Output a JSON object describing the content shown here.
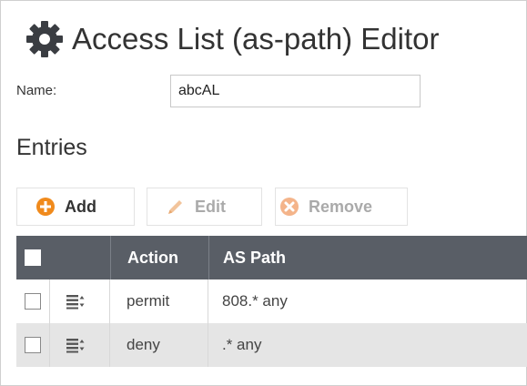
{
  "title": "Access List (as-path) Editor",
  "name_field": {
    "label": "Name:",
    "value": "abcAL"
  },
  "entries_heading": "Entries",
  "toolbar": {
    "add_label": "Add",
    "edit_label": "Edit",
    "remove_label": "Remove"
  },
  "grid": {
    "columns": {
      "action": "Action",
      "as_path": "AS Path"
    },
    "rows": [
      {
        "action": "permit",
        "as_path": "808.* any"
      },
      {
        "action": "deny",
        "as_path": ".* any"
      }
    ]
  },
  "colors": {
    "header_bg": "#595e66",
    "add_icon": "#f08a1c",
    "remove_icon": "#f4b48a",
    "edit_icon": "#f2c49b",
    "alt_row": "#e5e5e5"
  },
  "icons": {
    "title": "gear-icon",
    "add": "plus-circle-icon",
    "edit": "pencil-icon",
    "remove": "x-circle-icon",
    "row_handle": "reorder-icon"
  }
}
